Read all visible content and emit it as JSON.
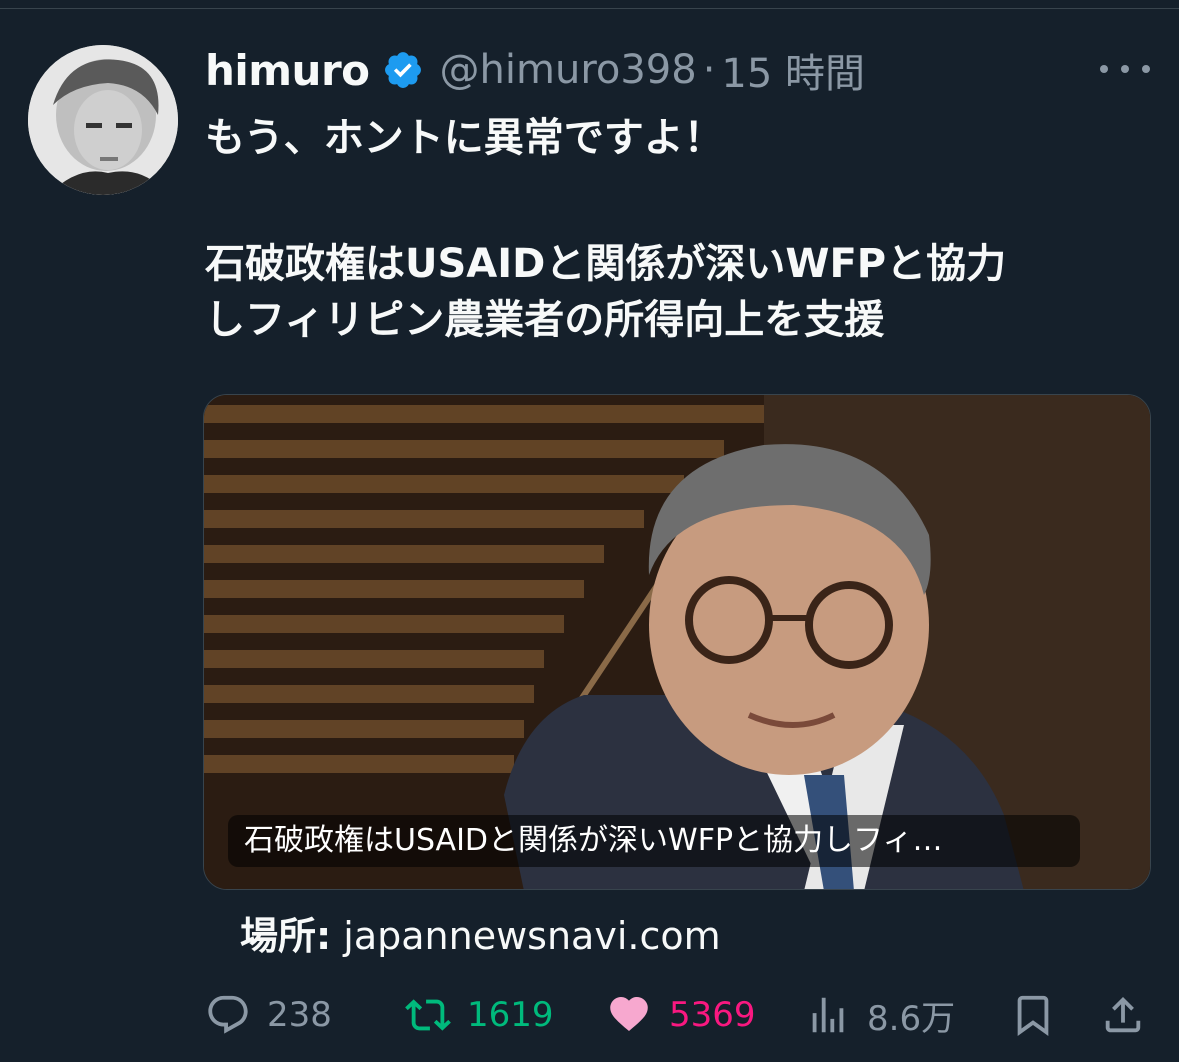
{
  "tweet": {
    "author_name": "himuro",
    "handle": "@himuro398",
    "separator": "·",
    "time": "15 時間",
    "text_line1": "もう、ホントに異常ですよ！",
    "text_line2": "石破政権はUSAIDと関係が深いWFPと協力",
    "text_line3": "しフィリピン農業者の所得向上を支援"
  },
  "card": {
    "caption": "石破政権はUSAIDと関係が深いWFPと協力しフィ…",
    "source_label": "場所:",
    "source_domain": "japannewsnavi.com"
  },
  "actions": {
    "replies": "238",
    "retweets": "1619",
    "likes": "5369",
    "views": "8.6万"
  },
  "icons": {
    "verified": "verified-badge-icon",
    "more": "more-icon",
    "reply": "reply-icon",
    "retweet": "retweet-icon",
    "like": "heart-icon",
    "views": "views-icon",
    "bookmark": "bookmark-icon",
    "share": "share-icon"
  },
  "colors": {
    "background": "#15202b",
    "text": "#f7f9f9",
    "secondary": "#8b98a5",
    "verified": "#1d9bf0",
    "retweet": "#00ba7c",
    "like": "#f91880"
  }
}
